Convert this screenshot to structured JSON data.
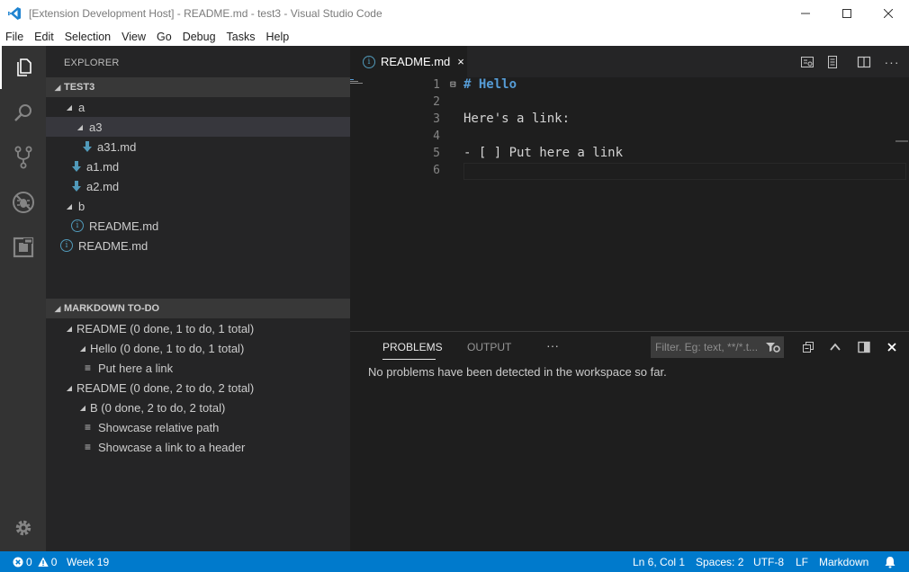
{
  "window": {
    "title": "[Extension Development Host] - README.md - test3 - Visual Studio Code",
    "minimize_icon": "minimize-icon",
    "maximize_icon": "maximize-icon",
    "close_icon": "close-icon"
  },
  "menu": [
    "File",
    "Edit",
    "Selection",
    "View",
    "Go",
    "Debug",
    "Tasks",
    "Help"
  ],
  "activity_bar": [
    "files-icon",
    "search-icon",
    "source-control-icon",
    "debug-icon",
    "extensions-icon",
    "gear-icon"
  ],
  "sidebar": {
    "title": "EXPLORER",
    "folder_header": "TEST3",
    "tree": [
      {
        "label": "a",
        "type": "folder"
      },
      {
        "label": "a3",
        "type": "folder"
      },
      {
        "label": "a31.md",
        "type": "markdown"
      },
      {
        "label": "a1.md",
        "type": "markdown"
      },
      {
        "label": "a2.md",
        "type": "markdown"
      },
      {
        "label": "b",
        "type": "folder"
      },
      {
        "label": "README.md",
        "type": "info"
      },
      {
        "label": "README.md",
        "type": "info"
      }
    ],
    "todo_header": "MARKDOWN TO-DO",
    "todo": [
      {
        "label": "README (0 done, 1 to do, 1 total)"
      },
      {
        "label": "Hello (0 done, 1 to do, 1 total)"
      },
      {
        "label": "Put here a link"
      },
      {
        "label": "README (0 done, 2 to do, 2 total)"
      },
      {
        "label": "B (0 done, 2 to do, 2 total)"
      },
      {
        "label": "Showcase relative path"
      },
      {
        "label": "Showcase a link to a header"
      }
    ]
  },
  "editor": {
    "tab_label": "README.md",
    "tab_close": "×",
    "line_numbers": [
      "1",
      "2",
      "3",
      "4",
      "5",
      "6"
    ],
    "lines": [
      "# Hello",
      "",
      "Here's a link:",
      "",
      "- [ ] Put here a link",
      ""
    ],
    "fold_marker": "⊟"
  },
  "panel": {
    "tabs": [
      "PROBLEMS",
      "OUTPUT"
    ],
    "more": "···",
    "filter_placeholder": "Filter. Eg: text, **/*.t...",
    "message": "No problems have been detected in the workspace so far."
  },
  "status_bar": {
    "errors": "0",
    "warnings": "0",
    "week": "Week 19",
    "position": "Ln 6, Col 1",
    "spaces": "Spaces: 2",
    "encoding": "UTF-8",
    "eol": "LF",
    "language": "Markdown"
  },
  "colors": {
    "accent": "#007acc",
    "markdown_heading": "#569cd6",
    "info_icon": "#519aba"
  }
}
